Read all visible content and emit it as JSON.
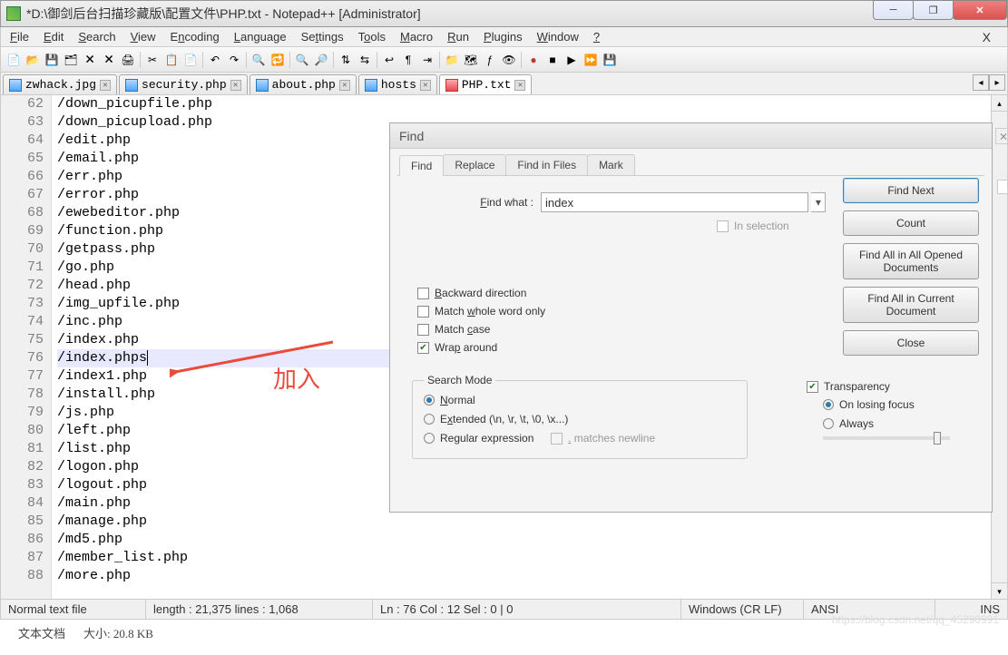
{
  "title": "*D:\\御剑后台扫描珍藏版\\配置文件\\PHP.txt - Notepad++ [Administrator]",
  "menu": [
    "File",
    "Edit",
    "Search",
    "View",
    "Encoding",
    "Language",
    "Settings",
    "Tools",
    "Macro",
    "Run",
    "Plugins",
    "Window",
    "?"
  ],
  "tabs": [
    {
      "name": "zwhack.jpg",
      "active": false
    },
    {
      "name": "security.php",
      "active": false
    },
    {
      "name": "about.php",
      "active": false
    },
    {
      "name": "hosts",
      "active": false
    },
    {
      "name": "PHP.txt",
      "active": true
    }
  ],
  "lines": [
    {
      "n": 62,
      "t": "/down_picupfile.php"
    },
    {
      "n": 63,
      "t": "/down_picupload.php"
    },
    {
      "n": 64,
      "t": "/edit.php"
    },
    {
      "n": 65,
      "t": "/email.php"
    },
    {
      "n": 66,
      "t": "/err.php"
    },
    {
      "n": 67,
      "t": "/error.php"
    },
    {
      "n": 68,
      "t": "/ewebeditor.php"
    },
    {
      "n": 69,
      "t": "/function.php"
    },
    {
      "n": 70,
      "t": "/getpass.php"
    },
    {
      "n": 71,
      "t": "/go.php"
    },
    {
      "n": 72,
      "t": "/head.php"
    },
    {
      "n": 73,
      "t": "/img_upfile.php"
    },
    {
      "n": 74,
      "t": "/inc.php"
    },
    {
      "n": 75,
      "t": "/index.php"
    },
    {
      "n": 76,
      "t": "/index.phps",
      "hl": true
    },
    {
      "n": 77,
      "t": "/index1.php"
    },
    {
      "n": 78,
      "t": "/install.php"
    },
    {
      "n": 79,
      "t": "/js.php"
    },
    {
      "n": 80,
      "t": "/left.php"
    },
    {
      "n": 81,
      "t": "/list.php"
    },
    {
      "n": 82,
      "t": "/logon.php"
    },
    {
      "n": 83,
      "t": "/logout.php"
    },
    {
      "n": 84,
      "t": "/main.php"
    },
    {
      "n": 85,
      "t": "/manage.php"
    },
    {
      "n": 86,
      "t": "/md5.php"
    },
    {
      "n": 87,
      "t": "/member_list.php"
    },
    {
      "n": 88,
      "t": "/more.php"
    }
  ],
  "annotation": "加入",
  "find": {
    "title": "Find",
    "tabs": [
      "Find",
      "Replace",
      "Find in Files",
      "Mark"
    ],
    "find_what_label": "Find what :",
    "find_what": "index",
    "in_selection": "In selection",
    "buttons": {
      "find_next": "Find Next",
      "count": "Count",
      "find_all_opened": "Find All in All Opened Documents",
      "find_all_current": "Find All in Current Document",
      "close": "Close"
    },
    "opts": {
      "backward": "Backward direction",
      "whole": "Match whole word only",
      "case": "Match case",
      "wrap": "Wrap around"
    },
    "search_mode": {
      "title": "Search Mode",
      "normal": "Normal",
      "extended": "Extended (\\n, \\r, \\t, \\0, \\x...)",
      "regex": "Regular expression",
      "dotnl": ". matches newline"
    },
    "transparency": {
      "title": "Transparency",
      "on_losing": "On losing focus",
      "always": "Always"
    }
  },
  "status": {
    "type": "Normal text file",
    "length": "length : 21,375    lines : 1,068",
    "pos": "Ln : 76    Col : 12    Sel : 0 | 0",
    "eol": "Windows (CR LF)",
    "enc": "ANSI",
    "ins": "INS"
  },
  "footer": {
    "type": "文本文档",
    "size_label": "大小:",
    "size": "20.8 KB"
  },
  "watermark": "https://blog.csdn.net/qq_45290991"
}
